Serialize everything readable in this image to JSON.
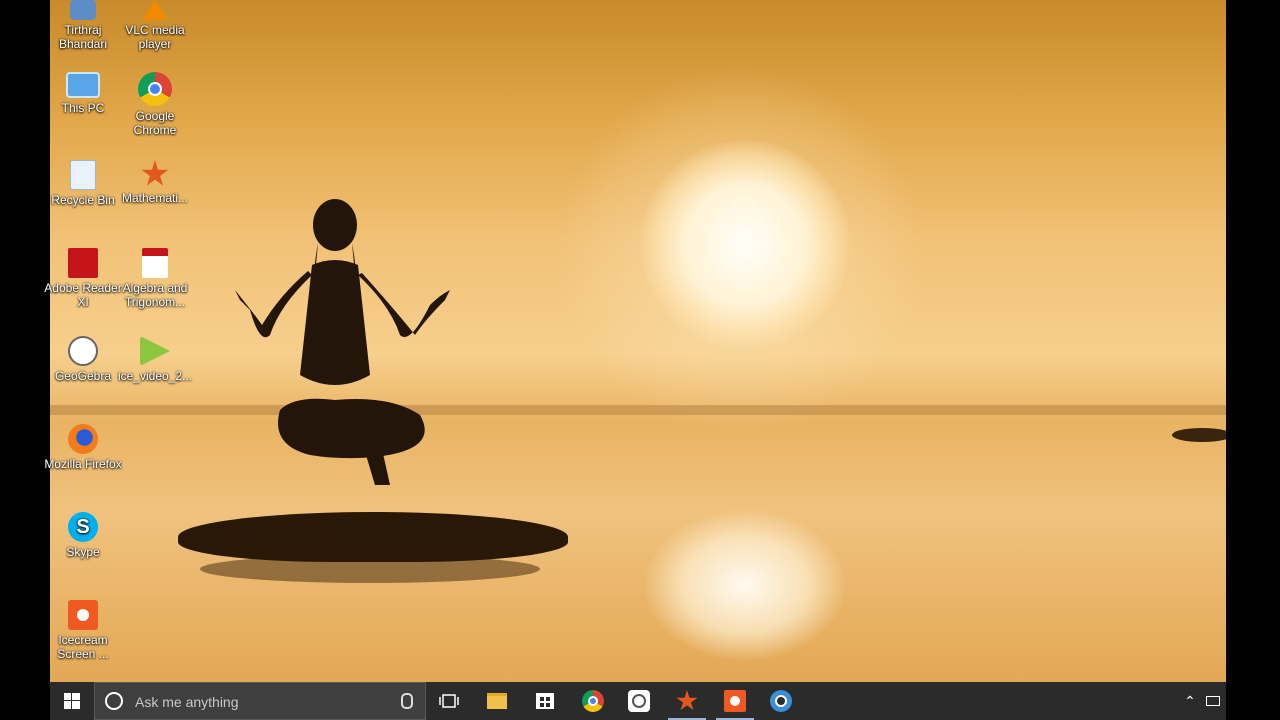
{
  "desktop": {
    "icons": [
      {
        "label": "Tirthraj Bhandari",
        "icon": "user-folder-icon"
      },
      {
        "label": "VLC media player",
        "icon": "vlc-icon"
      },
      {
        "label": "This PC",
        "icon": "computer-icon"
      },
      {
        "label": "Google Chrome",
        "icon": "chrome-icon"
      },
      {
        "label": "Recycle Bin",
        "icon": "recycle-bin-icon"
      },
      {
        "label": "Mathemati...",
        "icon": "mathematica-icon"
      },
      {
        "label": "Adobe Reader XI",
        "icon": "adobe-reader-icon"
      },
      {
        "label": "Algebra and Trigonom...",
        "icon": "pdf-file-icon"
      },
      {
        "label": "GeoGebra",
        "icon": "geogebra-icon"
      },
      {
        "label": "ice_video_2...",
        "icon": "video-file-icon"
      },
      {
        "label": "Mozilla Firefox",
        "icon": "firefox-icon"
      },
      {
        "label": "Skype",
        "icon": "skype-icon"
      },
      {
        "label": "Icecream Screen ...",
        "icon": "icecream-recorder-icon"
      }
    ]
  },
  "taskbar": {
    "search_placeholder": "Ask me anything",
    "pinned": [
      "task-view",
      "file-explorer",
      "store",
      "chrome",
      "geogebra",
      "mathematica",
      "icecream-recorder",
      "cortana-app"
    ],
    "colors": {
      "taskbar": "#2b2b2b",
      "active_indicator": "#9bb4d8"
    }
  }
}
